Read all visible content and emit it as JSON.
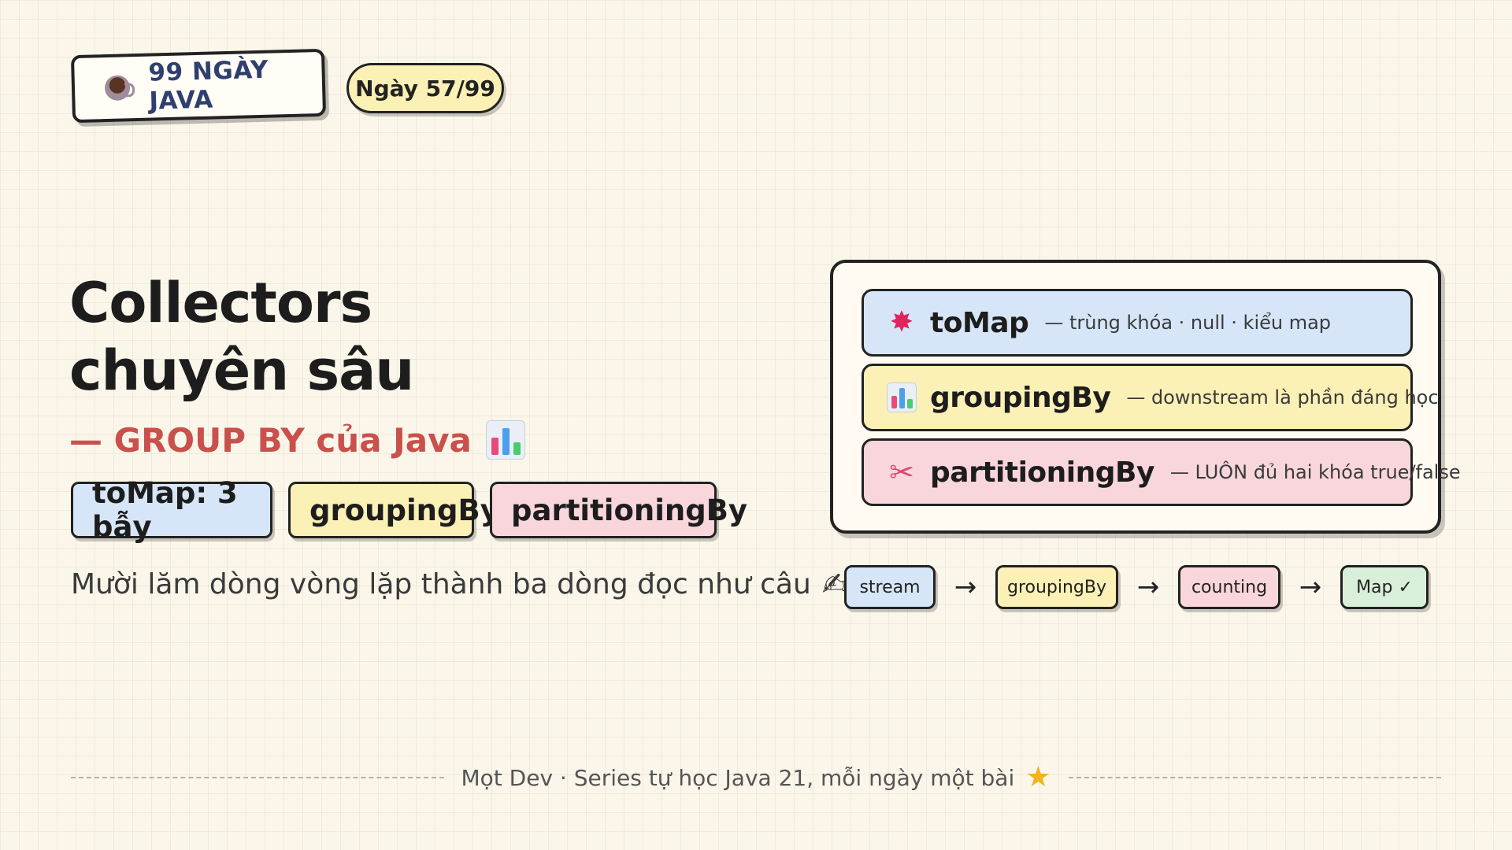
{
  "header": {
    "series_title": "99 NGÀY JAVA",
    "day_badge": "Ngày 57/99"
  },
  "title": {
    "line1": "Collectors",
    "line2": "chuyên sâu",
    "subtitle": "— GROUP BY của Java"
  },
  "tags": [
    {
      "label": "toMap: 3 bẫy",
      "color": "#d6e6f8"
    },
    {
      "label": "groupingBy",
      "color": "#fbf0b5"
    },
    {
      "label": "partitioningBy",
      "color": "#f9d6dc"
    }
  ],
  "tagline": "Mười lăm dòng vòng lặp thành ba dòng đọc như câu",
  "panel": {
    "cards": [
      {
        "icon": "burst-icon",
        "title": "toMap",
        "desc": "— trùng khóa · null · kiểu map",
        "color": "#d6e6f8"
      },
      {
        "icon": "bar-chart-icon",
        "title": "groupingBy",
        "desc": "— downstream là phần đáng học",
        "color": "#fbf0b5"
      },
      {
        "icon": "scissors-icon",
        "title": "partitioningBy",
        "desc": "— LUÔN đủ hai khóa true/false",
        "color": "#f9d6dc"
      }
    ]
  },
  "pipeline": {
    "steps": [
      "stream",
      "groupingBy",
      "counting",
      "Map ✓"
    ],
    "arrow": "→"
  },
  "footer": {
    "text": "Mọt Dev · Series tự học Java 21, mỗi ngày một bài"
  },
  "icons": {
    "coffee": "coffee-icon",
    "chart": "bar-chart-icon",
    "writing_hand": "writing-hand-icon",
    "star": "star-icon"
  },
  "colors": {
    "background": "#fbf6ea",
    "accent_red": "#c9504b",
    "series_blue": "#2f3f6e",
    "blue": "#d6e6f8",
    "yellow": "#fbf0b5",
    "pink": "#f9d6dc",
    "green": "#d9efd9"
  }
}
